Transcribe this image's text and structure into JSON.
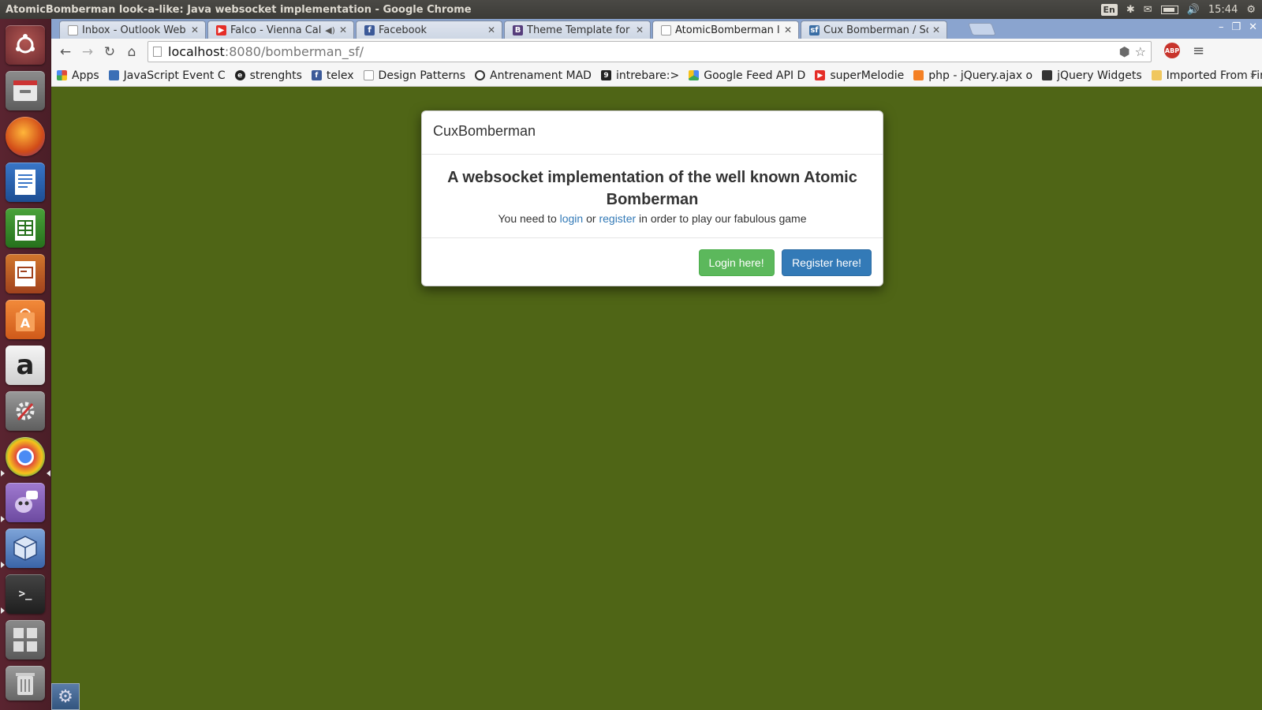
{
  "window": {
    "title": "AtomicBomberman look-a-like: Java websocket implementation - Google Chrome"
  },
  "indicators": {
    "language": "En",
    "clock": "15:44"
  },
  "tabs": [
    {
      "label": "Inbox - Outlook Web A",
      "icon": "page-icon"
    },
    {
      "label": "Falco - Vienna Callin",
      "icon": "youtube-icon"
    },
    {
      "label": "Facebook",
      "icon": "facebook-icon"
    },
    {
      "label": "Theme Template for B",
      "icon": "bootstrap-icon"
    },
    {
      "label": "AtomicBomberman lo",
      "icon": "page-icon",
      "active": true
    },
    {
      "label": "Cux Bomberman / Scr",
      "icon": "sf-icon"
    }
  ],
  "omnibox": {
    "host": "localhost",
    "path": ":8080/bomberman_sf/"
  },
  "bookmarks": [
    {
      "label": "Apps",
      "icon": "apps-grid-icon"
    },
    {
      "label": "JavaScript Event C",
      "icon": "bookmark-icon"
    },
    {
      "label": "strenghts",
      "icon": "bookmark-icon"
    },
    {
      "label": "telex",
      "icon": "facebook-icon"
    },
    {
      "label": "Design Patterns",
      "icon": "page-icon"
    },
    {
      "label": "Antrenament MAD",
      "icon": "chat-icon"
    },
    {
      "label": "intrebare:>",
      "icon": "bookmark-icon"
    },
    {
      "label": "Google Feed API D",
      "icon": "google-icon"
    },
    {
      "label": "superMelodie",
      "icon": "youtube-icon"
    },
    {
      "label": "php - jQuery.ajax o",
      "icon": "bookmark-icon"
    },
    {
      "label": "jQuery Widgets",
      "icon": "bookmark-icon"
    },
    {
      "label": "Imported From Fir",
      "icon": "folder-icon"
    }
  ],
  "modal": {
    "title": "CuxBomberman",
    "heading": "A websocket implementation of the well known Atomic Bomberman",
    "text_before": "You need to",
    "login_link": "login",
    "text_or": "or",
    "register_link": "register",
    "text_after": "in order to play our fabulous game",
    "login_button": "Login here!",
    "register_button": "Register here!"
  },
  "launcher": {
    "amazon_glyph": "a",
    "terminal_glyph": ">_"
  },
  "colors": {
    "page_background": "#4f6516",
    "success": "#5cb85c",
    "primary": "#337ab7",
    "link": "#337ab7"
  }
}
